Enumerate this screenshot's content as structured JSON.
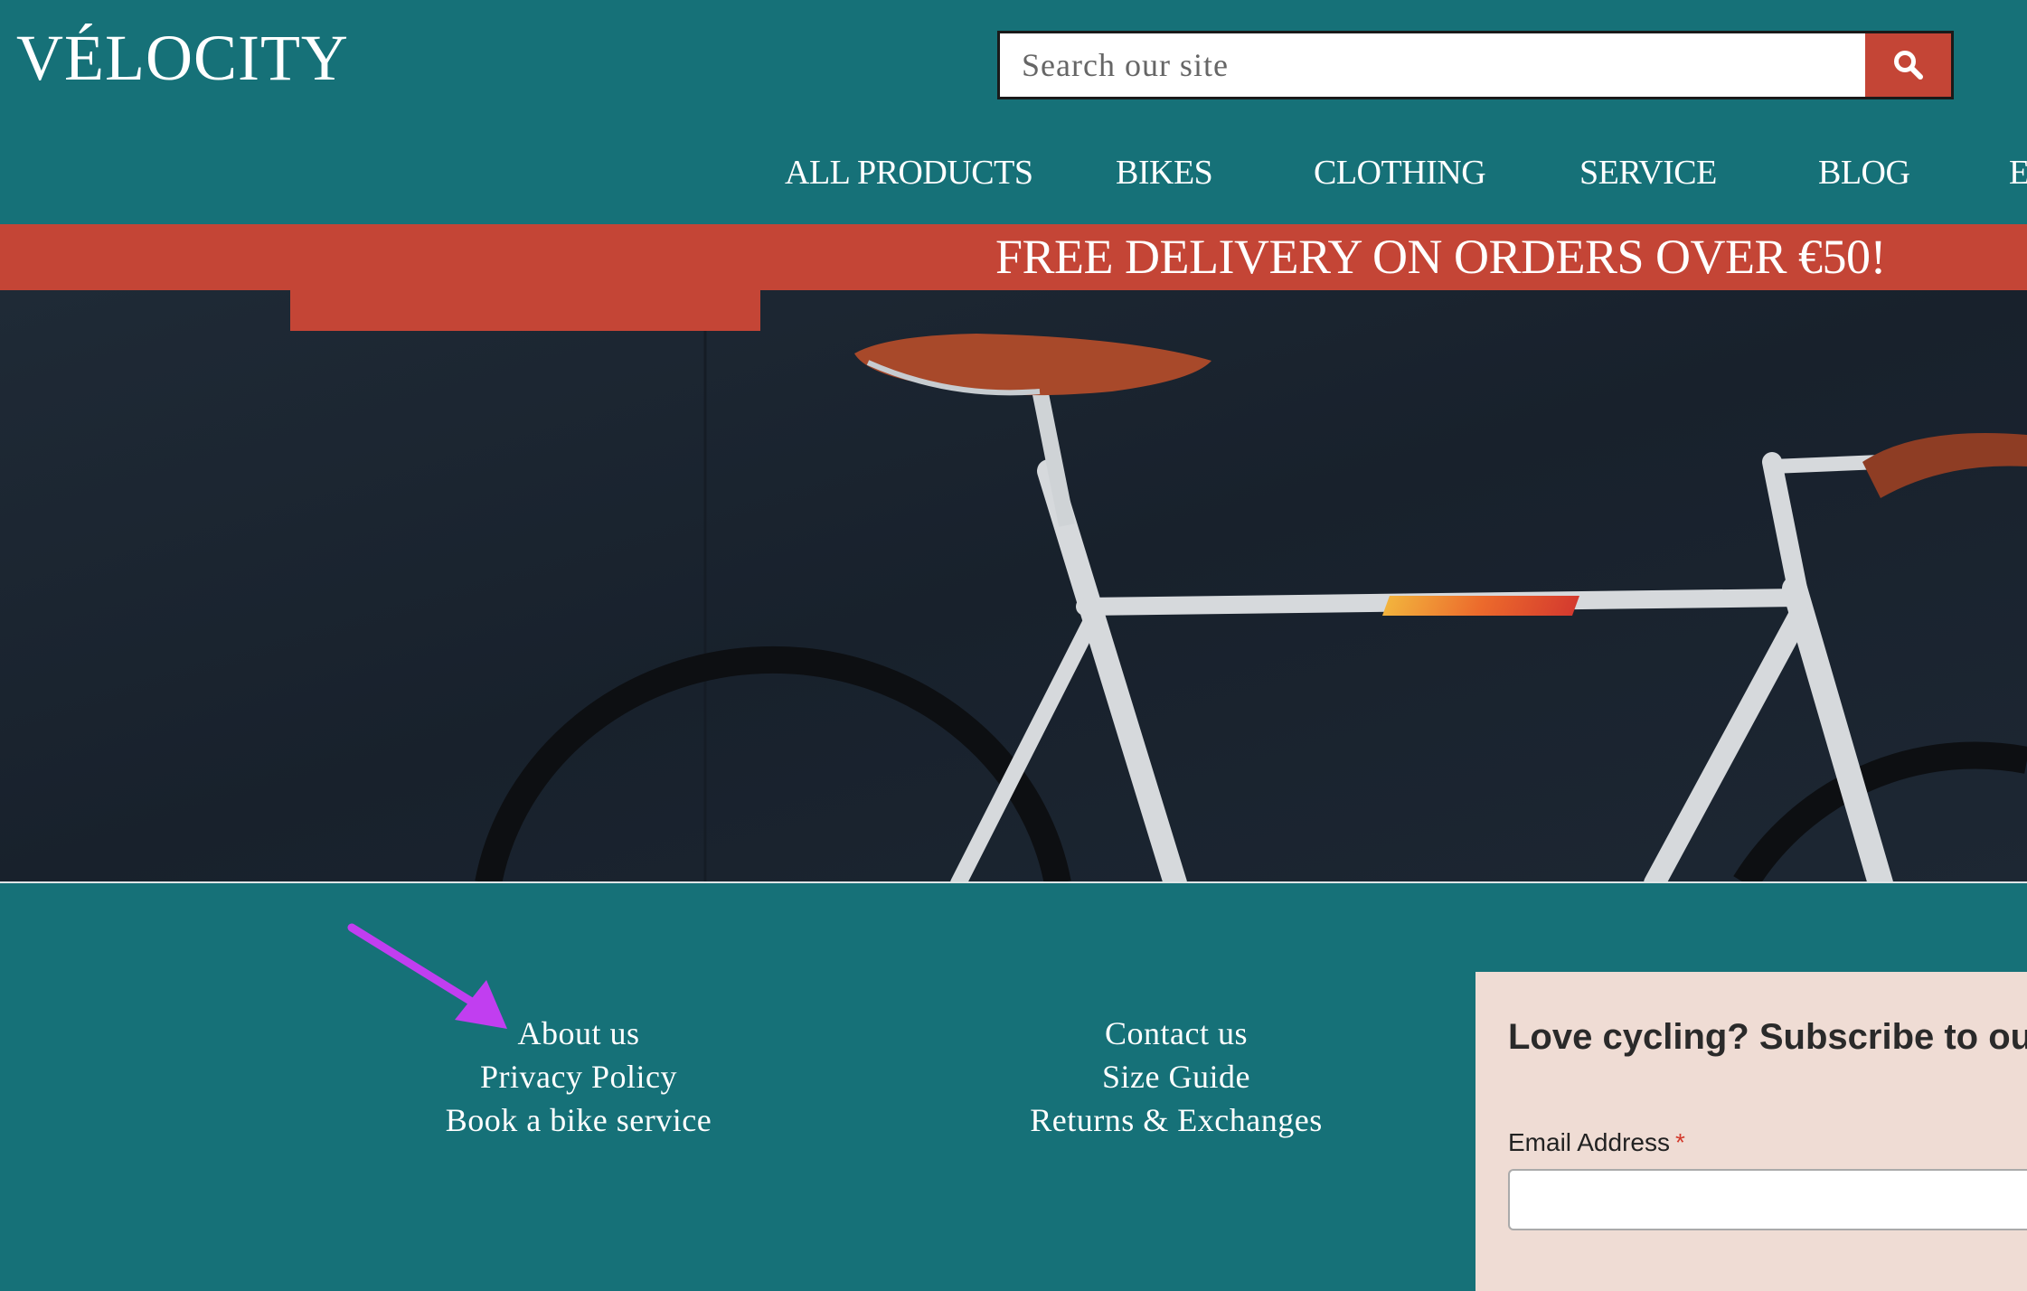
{
  "header": {
    "logo": "VÉLOCITY",
    "search": {
      "placeholder": "Search our site",
      "button_icon": "search-icon"
    }
  },
  "nav": {
    "items": [
      "ALL PRODUCTS",
      "BIKES",
      "CLOTHING",
      "SERVICE",
      "BLOG",
      "E"
    ]
  },
  "banner": {
    "text": "FREE DELIVERY ON ORDERS OVER €50!"
  },
  "hero": {
    "image": "bicycle-photo"
  },
  "footer": {
    "col1": [
      "About us",
      "Privacy Policy",
      "Book a bike service"
    ],
    "col2": [
      "Contact us",
      "Size Guide",
      "Returns & Exchanges"
    ],
    "subscribe": {
      "title": "Love cycling? Subscribe to our",
      "email_label": "Email Address",
      "required_mark": "*"
    }
  },
  "annotation": {
    "arrow_color": "#c13ef0",
    "arrow_icon": "arrow-annotation-icon"
  },
  "colors": {
    "teal": "#167178",
    "red": "#c44536",
    "panel": "#efdcd4"
  }
}
